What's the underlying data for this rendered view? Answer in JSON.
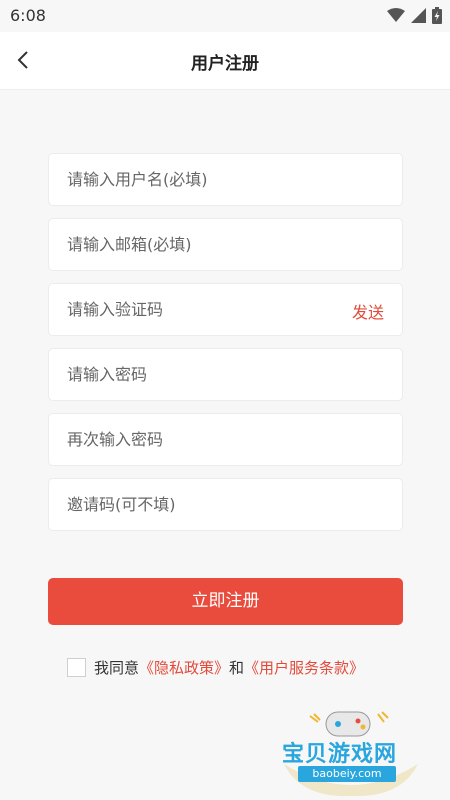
{
  "status_bar": {
    "time": "6:08"
  },
  "header": {
    "title": "用户注册"
  },
  "form": {
    "username_placeholder": "请输入用户名(必填)",
    "email_placeholder": "请输入邮箱(必填)",
    "code_placeholder": "请输入验证码",
    "send_label": "发送",
    "password_placeholder": "请输入密码",
    "confirm_placeholder": "再次输入密码",
    "invite_placeholder": "邀请码(可不填)",
    "submit_label": "立即注册"
  },
  "agreement": {
    "prefix": "我同意",
    "privacy": "《隐私政策》",
    "and": "和",
    "terms": "《用户服务条款》"
  },
  "watermark": {
    "brand": "宝贝游戏网",
    "url": "baobeiy.com"
  },
  "colors": {
    "accent": "#e94c3d",
    "link": "#e14b3b",
    "background": "#f7f7f7"
  }
}
